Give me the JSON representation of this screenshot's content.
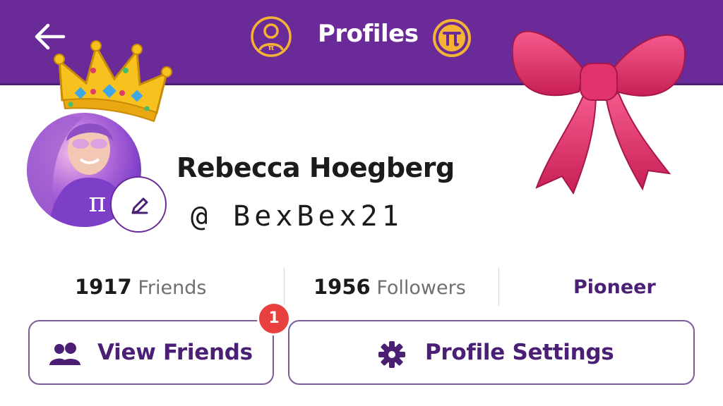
{
  "header": {
    "title": "Profiles",
    "back_icon": "arrow-left-icon",
    "left_icon": "profile-head-icon",
    "right_icon": "pi-logo-icon"
  },
  "stickers": [
    "crown",
    "pink-bow"
  ],
  "profile": {
    "display_name": "Rebecca Hoegberg",
    "username": "@ BexBex21",
    "avatar": "avatar-photo"
  },
  "stats": {
    "friends_count": "1917",
    "friends_label": "Friends",
    "followers_count": "1956",
    "followers_label": "Followers",
    "role": "Pioneer"
  },
  "actions": {
    "view_friends_label": "View Friends",
    "view_friends_badge": "1",
    "profile_settings_label": "Profile Settings"
  },
  "colors": {
    "header_bg": "#6a2a97",
    "accent": "#4b1f74",
    "pi_gold": "#f5b335",
    "badge_red": "#e8403f"
  }
}
